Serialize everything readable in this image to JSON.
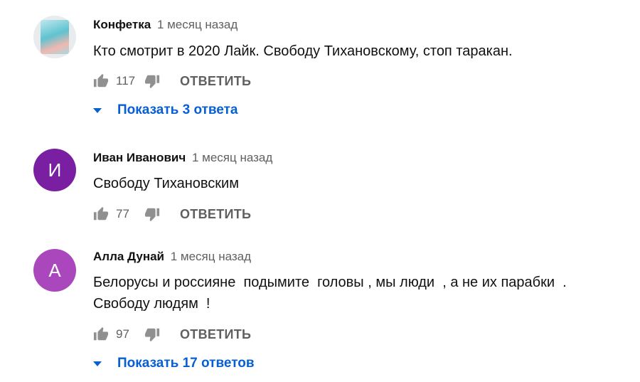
{
  "comments": [
    {
      "author": "Конфетка",
      "time": "1 месяц назад",
      "text": "Кто смотрит в 2020 Лайк. Свободу Тихановскому, стоп таракан.",
      "likes": "117",
      "reply_label": "ОТВЕТИТЬ",
      "replies_label": "Показать 3 ответа",
      "avatar_type": "image"
    },
    {
      "author": "Иван Иванович",
      "time": "1 месяц назад",
      "text": "Свободу Тихановским",
      "likes": "77",
      "reply_label": "ОТВЕТИТЬ",
      "avatar_letter": "И",
      "avatar_color": "#7b1fa2"
    },
    {
      "author": "Алла Дунай",
      "time": "1 месяц назад",
      "text_line1": "Белорусы и россияне  подымите  головы , мы люди  , а не их парабки  .",
      "text_line2": "Свободу людям  !",
      "likes": "97",
      "reply_label": "ОТВЕТИТЬ",
      "replies_label": "Показать 17 ответов",
      "avatar_letter": "А",
      "avatar_color": "#ab47bc"
    }
  ],
  "icons": {
    "like": "thumb-up-icon",
    "dislike": "thumb-down-icon",
    "expand": "caret-down-icon"
  }
}
